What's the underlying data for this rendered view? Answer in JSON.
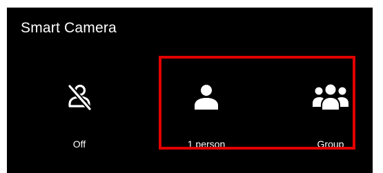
{
  "window": {
    "title": "Smart Camera"
  },
  "options": [
    {
      "label": "Off",
      "icon": "person-off-icon"
    },
    {
      "label": "1 person",
      "icon": "person-icon"
    },
    {
      "label": "Group",
      "icon": "group-icon"
    }
  ],
  "colors": {
    "background": "#000000",
    "text": "#ffffff",
    "highlight": "#e10000"
  }
}
